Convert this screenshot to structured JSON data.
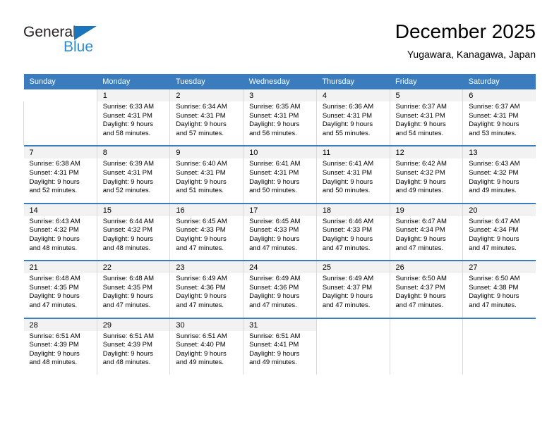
{
  "brand": {
    "name_part1": "General",
    "name_part2": "Blue",
    "triangle_icon": "triangle-icon",
    "accent_color": "#2e8bd0",
    "dark_color": "#231f20"
  },
  "header": {
    "title": "December 2025",
    "subtitle": "Yugawara, Kanagawa, Japan"
  },
  "calendar": {
    "header_bg": "#3a7cbe",
    "daynum_bg": "#f2f2f2",
    "weekdays": [
      "Sunday",
      "Monday",
      "Tuesday",
      "Wednesday",
      "Thursday",
      "Friday",
      "Saturday"
    ],
    "weeks": [
      [
        {
          "day": "",
          "sunrise": "",
          "sunset": "",
          "daylight1": "",
          "daylight2": ""
        },
        {
          "day": "1",
          "sunrise": "Sunrise: 6:33 AM",
          "sunset": "Sunset: 4:31 PM",
          "daylight1": "Daylight: 9 hours",
          "daylight2": "and 58 minutes."
        },
        {
          "day": "2",
          "sunrise": "Sunrise: 6:34 AM",
          "sunset": "Sunset: 4:31 PM",
          "daylight1": "Daylight: 9 hours",
          "daylight2": "and 57 minutes."
        },
        {
          "day": "3",
          "sunrise": "Sunrise: 6:35 AM",
          "sunset": "Sunset: 4:31 PM",
          "daylight1": "Daylight: 9 hours",
          "daylight2": "and 56 minutes."
        },
        {
          "day": "4",
          "sunrise": "Sunrise: 6:36 AM",
          "sunset": "Sunset: 4:31 PM",
          "daylight1": "Daylight: 9 hours",
          "daylight2": "and 55 minutes."
        },
        {
          "day": "5",
          "sunrise": "Sunrise: 6:37 AM",
          "sunset": "Sunset: 4:31 PM",
          "daylight1": "Daylight: 9 hours",
          "daylight2": "and 54 minutes."
        },
        {
          "day": "6",
          "sunrise": "Sunrise: 6:37 AM",
          "sunset": "Sunset: 4:31 PM",
          "daylight1": "Daylight: 9 hours",
          "daylight2": "and 53 minutes."
        }
      ],
      [
        {
          "day": "7",
          "sunrise": "Sunrise: 6:38 AM",
          "sunset": "Sunset: 4:31 PM",
          "daylight1": "Daylight: 9 hours",
          "daylight2": "and 52 minutes."
        },
        {
          "day": "8",
          "sunrise": "Sunrise: 6:39 AM",
          "sunset": "Sunset: 4:31 PM",
          "daylight1": "Daylight: 9 hours",
          "daylight2": "and 52 minutes."
        },
        {
          "day": "9",
          "sunrise": "Sunrise: 6:40 AM",
          "sunset": "Sunset: 4:31 PM",
          "daylight1": "Daylight: 9 hours",
          "daylight2": "and 51 minutes."
        },
        {
          "day": "10",
          "sunrise": "Sunrise: 6:41 AM",
          "sunset": "Sunset: 4:31 PM",
          "daylight1": "Daylight: 9 hours",
          "daylight2": "and 50 minutes."
        },
        {
          "day": "11",
          "sunrise": "Sunrise: 6:41 AM",
          "sunset": "Sunset: 4:31 PM",
          "daylight1": "Daylight: 9 hours",
          "daylight2": "and 50 minutes."
        },
        {
          "day": "12",
          "sunrise": "Sunrise: 6:42 AM",
          "sunset": "Sunset: 4:32 PM",
          "daylight1": "Daylight: 9 hours",
          "daylight2": "and 49 minutes."
        },
        {
          "day": "13",
          "sunrise": "Sunrise: 6:43 AM",
          "sunset": "Sunset: 4:32 PM",
          "daylight1": "Daylight: 9 hours",
          "daylight2": "and 49 minutes."
        }
      ],
      [
        {
          "day": "14",
          "sunrise": "Sunrise: 6:43 AM",
          "sunset": "Sunset: 4:32 PM",
          "daylight1": "Daylight: 9 hours",
          "daylight2": "and 48 minutes."
        },
        {
          "day": "15",
          "sunrise": "Sunrise: 6:44 AM",
          "sunset": "Sunset: 4:32 PM",
          "daylight1": "Daylight: 9 hours",
          "daylight2": "and 48 minutes."
        },
        {
          "day": "16",
          "sunrise": "Sunrise: 6:45 AM",
          "sunset": "Sunset: 4:33 PM",
          "daylight1": "Daylight: 9 hours",
          "daylight2": "and 47 minutes."
        },
        {
          "day": "17",
          "sunrise": "Sunrise: 6:45 AM",
          "sunset": "Sunset: 4:33 PM",
          "daylight1": "Daylight: 9 hours",
          "daylight2": "and 47 minutes."
        },
        {
          "day": "18",
          "sunrise": "Sunrise: 6:46 AM",
          "sunset": "Sunset: 4:33 PM",
          "daylight1": "Daylight: 9 hours",
          "daylight2": "and 47 minutes."
        },
        {
          "day": "19",
          "sunrise": "Sunrise: 6:47 AM",
          "sunset": "Sunset: 4:34 PM",
          "daylight1": "Daylight: 9 hours",
          "daylight2": "and 47 minutes."
        },
        {
          "day": "20",
          "sunrise": "Sunrise: 6:47 AM",
          "sunset": "Sunset: 4:34 PM",
          "daylight1": "Daylight: 9 hours",
          "daylight2": "and 47 minutes."
        }
      ],
      [
        {
          "day": "21",
          "sunrise": "Sunrise: 6:48 AM",
          "sunset": "Sunset: 4:35 PM",
          "daylight1": "Daylight: 9 hours",
          "daylight2": "and 47 minutes."
        },
        {
          "day": "22",
          "sunrise": "Sunrise: 6:48 AM",
          "sunset": "Sunset: 4:35 PM",
          "daylight1": "Daylight: 9 hours",
          "daylight2": "and 47 minutes."
        },
        {
          "day": "23",
          "sunrise": "Sunrise: 6:49 AM",
          "sunset": "Sunset: 4:36 PM",
          "daylight1": "Daylight: 9 hours",
          "daylight2": "and 47 minutes."
        },
        {
          "day": "24",
          "sunrise": "Sunrise: 6:49 AM",
          "sunset": "Sunset: 4:36 PM",
          "daylight1": "Daylight: 9 hours",
          "daylight2": "and 47 minutes."
        },
        {
          "day": "25",
          "sunrise": "Sunrise: 6:49 AM",
          "sunset": "Sunset: 4:37 PM",
          "daylight1": "Daylight: 9 hours",
          "daylight2": "and 47 minutes."
        },
        {
          "day": "26",
          "sunrise": "Sunrise: 6:50 AM",
          "sunset": "Sunset: 4:37 PM",
          "daylight1": "Daylight: 9 hours",
          "daylight2": "and 47 minutes."
        },
        {
          "day": "27",
          "sunrise": "Sunrise: 6:50 AM",
          "sunset": "Sunset: 4:38 PM",
          "daylight1": "Daylight: 9 hours",
          "daylight2": "and 47 minutes."
        }
      ],
      [
        {
          "day": "28",
          "sunrise": "Sunrise: 6:51 AM",
          "sunset": "Sunset: 4:39 PM",
          "daylight1": "Daylight: 9 hours",
          "daylight2": "and 48 minutes."
        },
        {
          "day": "29",
          "sunrise": "Sunrise: 6:51 AM",
          "sunset": "Sunset: 4:39 PM",
          "daylight1": "Daylight: 9 hours",
          "daylight2": "and 48 minutes."
        },
        {
          "day": "30",
          "sunrise": "Sunrise: 6:51 AM",
          "sunset": "Sunset: 4:40 PM",
          "daylight1": "Daylight: 9 hours",
          "daylight2": "and 49 minutes."
        },
        {
          "day": "31",
          "sunrise": "Sunrise: 6:51 AM",
          "sunset": "Sunset: 4:41 PM",
          "daylight1": "Daylight: 9 hours",
          "daylight2": "and 49 minutes."
        },
        {
          "day": "",
          "sunrise": "",
          "sunset": "",
          "daylight1": "",
          "daylight2": ""
        },
        {
          "day": "",
          "sunrise": "",
          "sunset": "",
          "daylight1": "",
          "daylight2": ""
        },
        {
          "day": "",
          "sunrise": "",
          "sunset": "",
          "daylight1": "",
          "daylight2": ""
        }
      ]
    ]
  }
}
